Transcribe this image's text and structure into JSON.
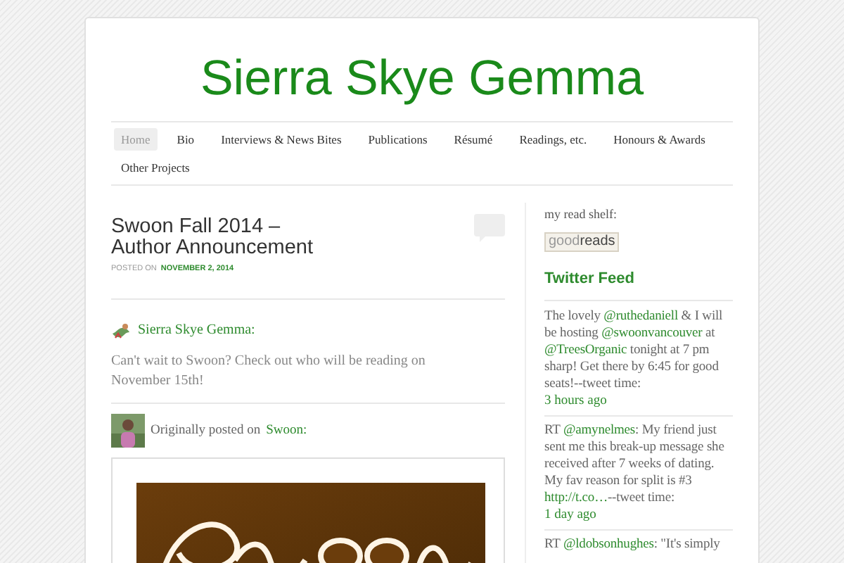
{
  "site": {
    "title": "Sierra Skye Gemma"
  },
  "nav": [
    {
      "label": "Home",
      "selected": true
    },
    {
      "label": "Bio",
      "selected": false
    },
    {
      "label": "Interviews & News Bites",
      "selected": false
    },
    {
      "label": "Publications",
      "selected": false
    },
    {
      "label": "Résumé",
      "selected": false
    },
    {
      "label": "Readings, etc.",
      "selected": false
    },
    {
      "label": "Honours & Awards",
      "selected": false
    },
    {
      "label": "Other Projects",
      "selected": false
    }
  ],
  "post": {
    "title": "Swoon Fall 2014 –\nAuthor Announcement",
    "posted_on": "POSTED ON",
    "date": "NOVEMBER 2, 2014",
    "reblogger": "Sierra Skye Gemma:",
    "comment": "Can't wait to Swoon? Check out who will be reading on November 15th!",
    "origin_prefix": "Originally posted on",
    "origin_link": "Swoon:"
  },
  "sidebar": {
    "shelf_label": "my read shelf:",
    "shelf_badge": "good**reads**",
    "twitter_title": "Twitter Feed",
    "tweets": [
      {
        "parts": [
          {
            "text": "The lovely ",
            "kind": "text"
          },
          {
            "text": "@ruthedaniell",
            "kind": "link"
          },
          {
            "text": " & I will be hosting ",
            "kind": "text"
          },
          {
            "text": "@swoonvancouver",
            "kind": "link"
          },
          {
            "text": " at ",
            "kind": "text"
          },
          {
            "text": "@TreesOrganic",
            "kind": "link"
          },
          {
            "text": " tonight at 7 pm sharp! Get there by 6:45 for good seats!--tweet time:",
            "kind": "text"
          }
        ],
        "time": "3 hours ago"
      },
      {
        "parts": [
          {
            "text": "RT ",
            "kind": "text"
          },
          {
            "text": "@amynelmes",
            "kind": "link"
          },
          {
            "text": ": My friend just sent me this break-up message she received after 7 weeks of dating. My fav reason for split is #3 ",
            "kind": "text"
          },
          {
            "text": "http://t.co…",
            "kind": "link"
          },
          {
            "text": "--tweet time:",
            "kind": "text"
          }
        ],
        "time": "1 day ago"
      },
      {
        "parts": [
          {
            "text": "RT ",
            "kind": "text"
          },
          {
            "text": "@ldobsonhughes",
            "kind": "link"
          },
          {
            "text": ": \"It's simply",
            "kind": "text"
          }
        ]
      }
    ]
  }
}
